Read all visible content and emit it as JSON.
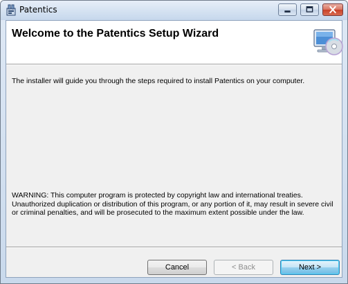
{
  "window": {
    "title": "Patentics",
    "app_icon": "installer-app-icon"
  },
  "caption_buttons": {
    "minimize": "minimize-icon",
    "maximize": "maximize-icon",
    "close": "close-icon"
  },
  "banner": {
    "title": "Welcome to the Patentics Setup Wizard",
    "icon": "computer-cd-icon"
  },
  "body": {
    "intro": "The installer will guide you through the steps required to install Patentics on your computer.",
    "warning": "WARNING: This computer program is protected by copyright law and international treaties.\nUnauthorized duplication or distribution of this program, or any portion of it, may result in severe civil\nor criminal penalties, and will be prosecuted to the maximum extent possible under the law."
  },
  "buttons": {
    "cancel": "Cancel",
    "back": "< Back",
    "next": "Next >",
    "back_enabled": false
  },
  "colors": {
    "accent": "#3c7fb1",
    "client_bg": "#f0f0f0"
  }
}
